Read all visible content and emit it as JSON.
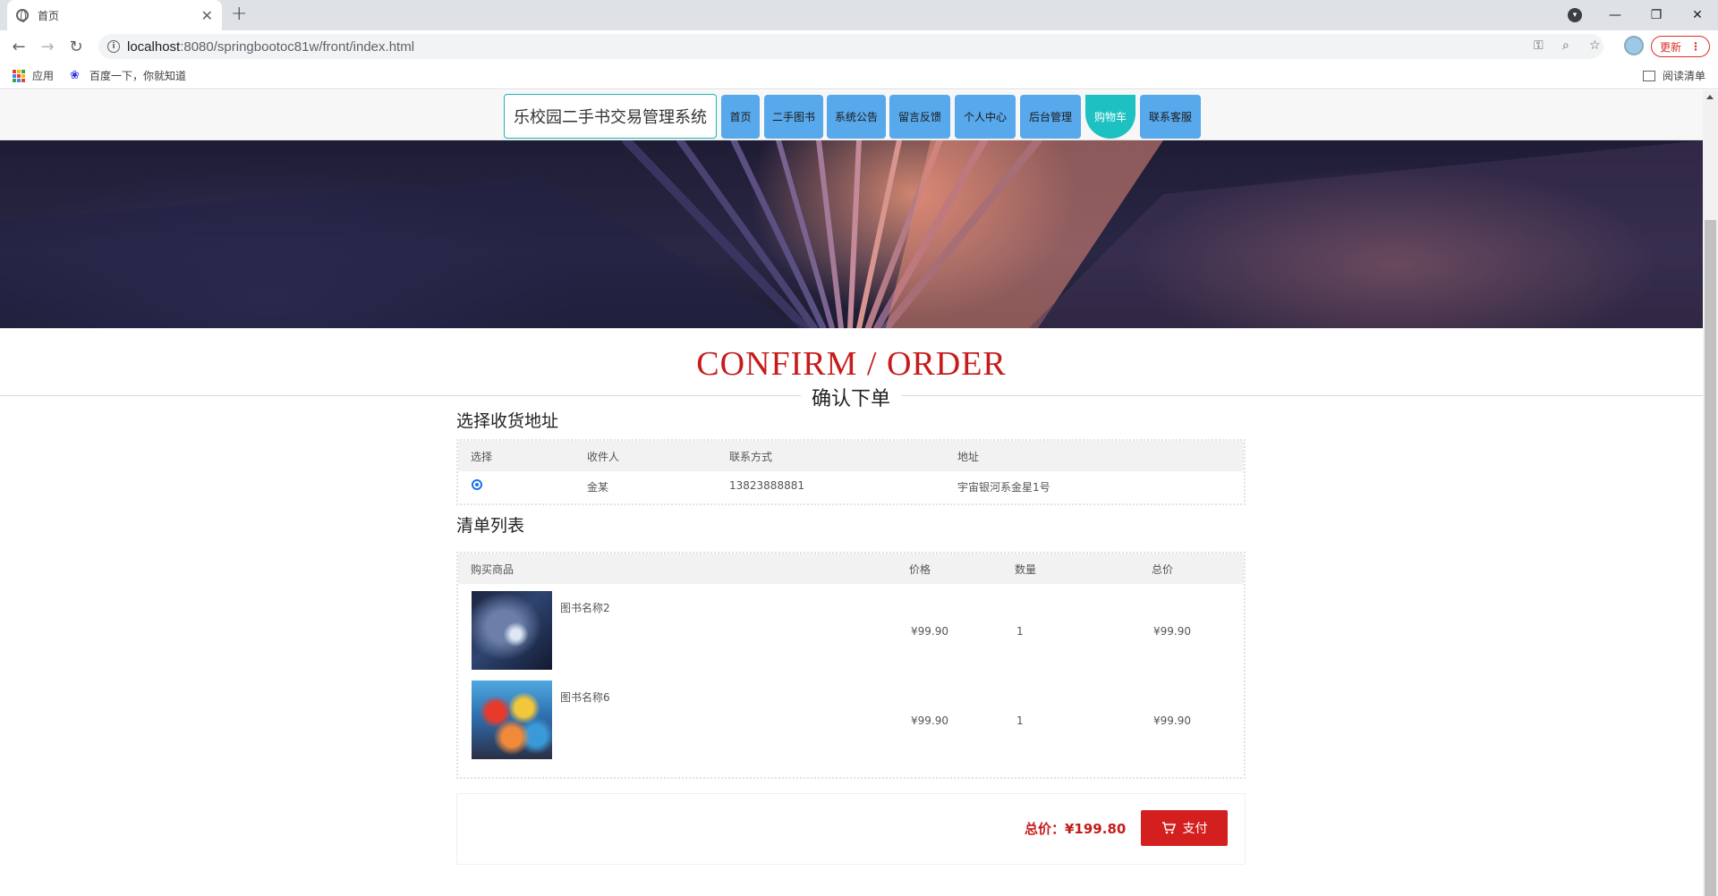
{
  "browser": {
    "tab_title": "首页",
    "tab_close": "✕",
    "new_tab": "+",
    "url_host": "localhost",
    "url_path": ":8080/springbootoc81w/front/index.html",
    "update_label": "更新",
    "win_minimize": "—",
    "win_restore": "❐",
    "win_close": "✕",
    "bookmarks": {
      "apps": "应用",
      "baidu": "百度一下，你就知道",
      "reading_list": "阅读清单"
    }
  },
  "nav": {
    "site_title": "乐校园二手书交易管理系统",
    "items": [
      {
        "label": "首页",
        "active": false
      },
      {
        "label": "二手图书",
        "active": false
      },
      {
        "label": "系统公告",
        "active": false
      },
      {
        "label": "留言反馈",
        "active": false
      },
      {
        "label": "个人中心",
        "active": false
      },
      {
        "label": "后台管理",
        "active": false
      },
      {
        "label": "购物车",
        "active": true
      },
      {
        "label": "联系客服",
        "active": false
      }
    ],
    "active_color": "#1ec1c1",
    "item_color": "#58a8ec"
  },
  "heading": {
    "en": "CONFIRM / ORDER",
    "cn": "确认下单"
  },
  "address": {
    "section_title": "选择收货地址",
    "columns": [
      "选择",
      "收件人",
      "联系方式",
      "地址"
    ],
    "rows": [
      {
        "selected": true,
        "recipient": "金某",
        "phone": "13823888881",
        "address": "宇宙银河系金星1号"
      }
    ]
  },
  "order_list": {
    "section_title": "清单列表",
    "columns": [
      "购买商品",
      "价格",
      "数量",
      "总价"
    ],
    "rows": [
      {
        "name": "图书名称2",
        "image": "dark-dragon-illustration",
        "price": "¥99.90",
        "qty": "1",
        "total": "¥99.90"
      },
      {
        "name": "图书名称6",
        "image": "anime-pirate-crew",
        "price": "¥99.90",
        "qty": "1",
        "total": "¥99.90"
      }
    ]
  },
  "payment": {
    "total_label": "总价：¥199.80",
    "pay_button": "支付"
  },
  "colors": {
    "accent_red": "#c61b1b",
    "pay_button": "#d41f1f"
  }
}
